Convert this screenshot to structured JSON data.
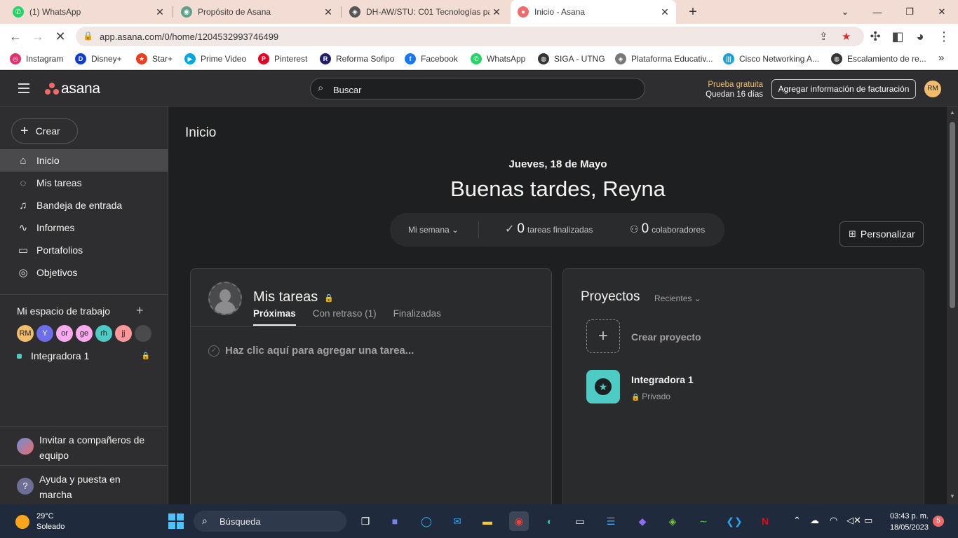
{
  "browser": {
    "tabs": [
      {
        "title": "(1) WhatsApp",
        "color": "#25d366"
      },
      {
        "title": "Propósito de Asana",
        "color": "#5fa08b"
      },
      {
        "title": "DH-AW/STU: C01 Tecnologías pa",
        "color": "#555555"
      },
      {
        "title": "Inicio - Asana",
        "color": "#f06a6a"
      }
    ],
    "url": "app.asana.com/0/home/1204532993746499",
    "bookmarks": [
      {
        "label": "Instagram",
        "color": "#e1306c"
      },
      {
        "label": "Disney+",
        "color": "#113ccf"
      },
      {
        "label": "Star+",
        "color": "#e6401e"
      },
      {
        "label": "Prime Video",
        "color": "#00a8e1"
      },
      {
        "label": "Pinterest",
        "color": "#e60023"
      },
      {
        "label": "Reforma Sofipo",
        "color": "#1d1d6b"
      },
      {
        "label": "Facebook",
        "color": "#1877f2"
      },
      {
        "label": "WhatsApp",
        "color": "#25d366"
      },
      {
        "label": "SIGA - UTNG",
        "color": "#333333"
      },
      {
        "label": "Plataforma Educativ...",
        "color": "#777777"
      },
      {
        "label": "Cisco Networking A...",
        "color": "#1ba0d7"
      },
      {
        "label": "Escalamiento de re...",
        "color": "#333333"
      }
    ]
  },
  "topbar": {
    "logo_text": "asana",
    "search_placeholder": "Buscar",
    "trial_line1": "Prueba gratuita",
    "trial_line2": "Quedan 16 días",
    "billing_button": "Agregar información de facturación",
    "user_initials": "RM"
  },
  "sidebar": {
    "create_label": "Crear",
    "items": [
      {
        "label": "Inicio",
        "icon": "⌂"
      },
      {
        "label": "Mis tareas",
        "icon": "✓"
      },
      {
        "label": "Bandeja de entrada",
        "icon": "🔔"
      },
      {
        "label": "Informes",
        "icon": "∿"
      },
      {
        "label": "Portafolios",
        "icon": "▭"
      },
      {
        "label": "Objetivos",
        "icon": "◎"
      }
    ],
    "workspace_title": "Mi espacio de trabajo",
    "members": [
      {
        "initials": "RM",
        "color": "#f1bd6c"
      },
      {
        "initials": "Y",
        "color": "#6d6ee9"
      },
      {
        "initials": "or",
        "color": "#f9aaef"
      },
      {
        "initials": "ge",
        "color": "#f9aaef"
      },
      {
        "initials": "rh",
        "color": "#4ecbc4"
      },
      {
        "initials": "jj",
        "color": "#fc979a"
      },
      {
        "initials": "",
        "color": "#4a4a4c"
      }
    ],
    "project_name": "Integradora 1",
    "invite_label": "Invitar a compañeros de equipo",
    "help_label": "Ayuda y puesta en marcha"
  },
  "main": {
    "page_title": "Inicio",
    "date": "Jueves, 18 de Mayo",
    "greeting": "Buenas tardes, Reyna",
    "week_selector": "Mi semana",
    "tasks_done_count": "0",
    "tasks_done_label": "tareas finalizadas",
    "collaborators_count": "0",
    "collaborators_label": "colaboradores",
    "customize_label": "Personalizar",
    "my_tasks": {
      "title": "Mis tareas",
      "tabs": [
        "Próximas",
        "Con retraso (1)",
        "Finalizadas"
      ],
      "add_task_prompt": "Haz clic aquí para agregar una tarea..."
    },
    "projects": {
      "title": "Proyectos",
      "filter": "Recientes",
      "create_label": "Crear proyecto",
      "project_name": "Integradora 1",
      "project_privacy": "Privado"
    }
  },
  "taskbar": {
    "temperature": "29°C",
    "weather": "Soleado",
    "search_label": "Búsqueda",
    "time": "03:43 p. m.",
    "date": "18/05/2023",
    "notifications": "5"
  }
}
